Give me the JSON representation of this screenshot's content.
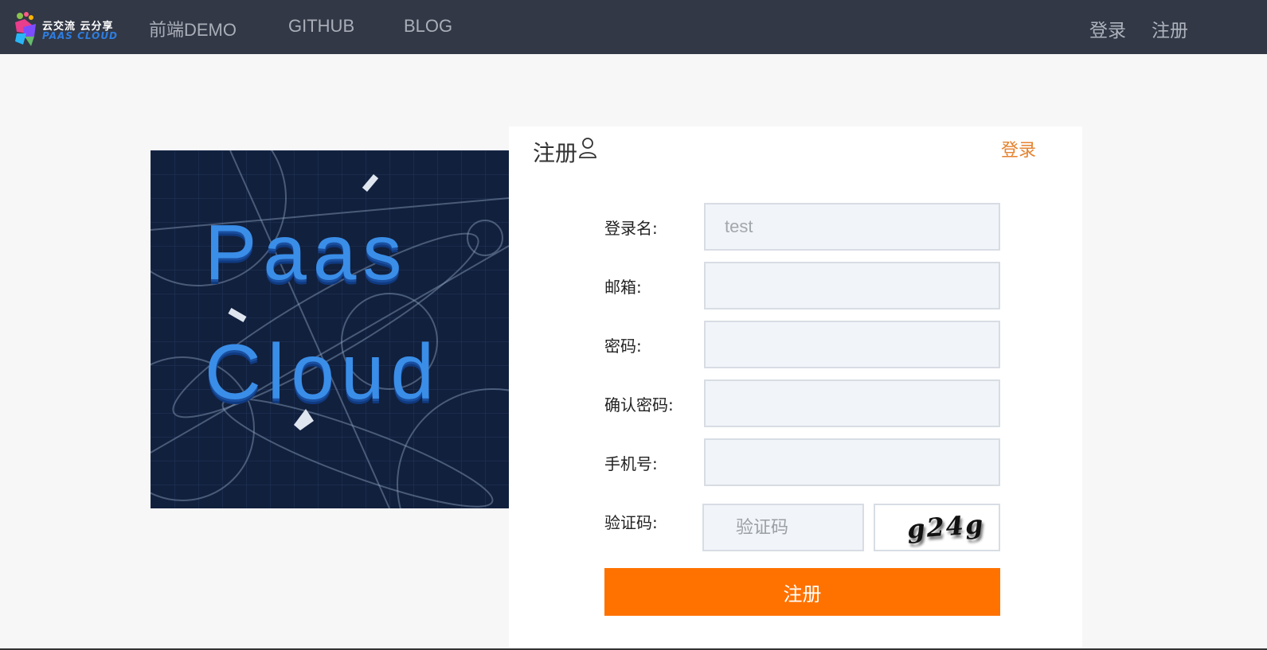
{
  "nav": {
    "logo_top": "云交流 云分享",
    "logo_bottom": "PAAS CLOUD",
    "links": [
      "前端DEMO",
      "GITHUB",
      "BLOG"
    ],
    "login": "登录",
    "register": "注册"
  },
  "banner": {
    "line1": "Paas",
    "line2": "Cloud"
  },
  "form": {
    "title": "注册",
    "login_link": "登录",
    "fields": [
      {
        "label": "登录名:",
        "value": "",
        "placeholder": "test"
      },
      {
        "label": "邮箱:",
        "value": "",
        "placeholder": ""
      },
      {
        "label": "密码:",
        "value": "",
        "placeholder": ""
      },
      {
        "label": "确认密码:",
        "value": "",
        "placeholder": ""
      },
      {
        "label": "手机号:",
        "value": "",
        "placeholder": ""
      }
    ],
    "captcha_label": "验证码:",
    "captcha_placeholder": "验证码",
    "captcha_text": "g24g",
    "submit_label": "注册"
  },
  "colors": {
    "nav_bg": "#323846",
    "accent": "#ff7200",
    "link_orange": "#e5822f"
  }
}
